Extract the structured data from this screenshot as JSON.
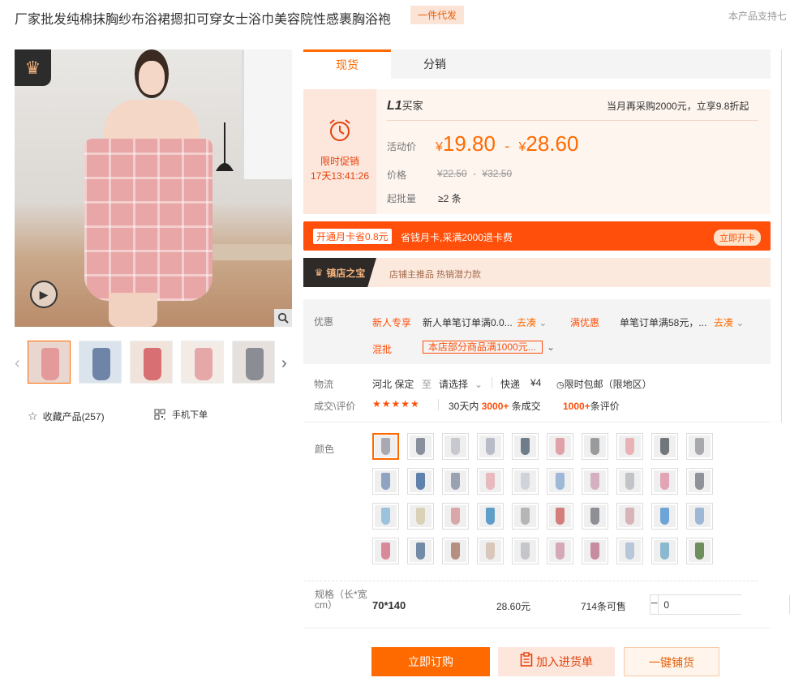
{
  "header": {
    "title": "厂家批发纯棉抹胸纱布浴裙摁扣可穿女士浴巾美容院性感裹胸浴袍",
    "dropship_tag": "一件代发",
    "support_text": "本产品支持七"
  },
  "gallery": {
    "zoom_icon": "magnifier-icon",
    "play_icon": "play-icon",
    "prev_icon": "chevron-left-icon",
    "next_icon": "chevron-right-icon",
    "thumb_count": 5,
    "favorite_label": "收藏产品(257)",
    "mobile_order_label": "手机下单"
  },
  "tabs": [
    {
      "label": "现货",
      "active": true
    },
    {
      "label": "分销",
      "active": false
    }
  ],
  "promo": {
    "badge_label": "限时促销",
    "countdown": "17天13:41:26",
    "level_code": "L1",
    "level_name": "买家",
    "level_hint": "当月再采购2000元，立享9.8折起",
    "activity_price_label": "活动价",
    "currency": "¥",
    "price_low": "19.80",
    "price_sep": "-",
    "price_high": "28.60",
    "orig_price_label": "价格",
    "orig_low": "22.50",
    "orig_high": "32.50",
    "moq_label": "起批量",
    "moq_value": "≥2 条"
  },
  "month_card": {
    "tag": "开通月卡省0.8元",
    "text": "省钱月卡,采满2000退卡费",
    "button": "立即开卡"
  },
  "treasure": {
    "title": "镇店之宝",
    "text": "店铺主推品  热销潜力款"
  },
  "offers": {
    "label": "优惠",
    "new_tag": "新人专享",
    "new_text": "新人单笔订单满0.0...",
    "go_label": "去凑",
    "full_tag": "满优惠",
    "full_text": "单笔订单满58元，...",
    "mix_tag": "混批",
    "mix_text": "本店部分商品满1000元..."
  },
  "logistics": {
    "label": "物流",
    "from": "河北 保定",
    "to_word": "至",
    "select_label": "请选择",
    "express": "快递",
    "fee": "¥4",
    "free_ship": "限时包邮（限地区）"
  },
  "deal": {
    "label": "成交\\评价",
    "stars": "★★★★★",
    "sold_prefix": "30天内",
    "sold_count": "3000+",
    "sold_unit": "条成交",
    "review_count": "1000+",
    "review_unit": "条评价"
  },
  "colors": {
    "label": "颜色",
    "swatches": [
      "#a9a9b3",
      "#8a8f9e",
      "#c7c9cf",
      "#b7bcc6",
      "#6f7c8a",
      "#e0a1a8",
      "#9a9b9d",
      "#e9b3b5",
      "#72777b",
      "#a7a9ad",
      "#8fa3c3",
      "#5f82ad",
      "#9aa2b1",
      "#e8b9bd",
      "#cfd4da",
      "#9fb8d8",
      "#d5b0c1",
      "#c2c4c8",
      "#e3a5b5",
      "#8e9399",
      "#9cc3dd",
      "#d9d2b8",
      "#d9a7aa",
      "#5e9ec8",
      "#b6b6b6",
      "#d47d7d",
      "#8d8f95",
      "#d8b3b8",
      "#6ea5d7",
      "#9db7d6",
      "#d88a9a",
      "#738aa7",
      "#b58f80",
      "#d9c7bb",
      "#c4c6cc",
      "#d4a9b5",
      "#c68ca0",
      "#b7c6d9",
      "#8ab9cf",
      "#6f8e5d"
    ]
  },
  "spec": {
    "label": "规格（长*宽cm）",
    "name": "70*140",
    "price": "28.60元",
    "stock": "714条可售",
    "minus": "−",
    "plus": "+",
    "quantity": "0"
  },
  "actions": {
    "order": "立即订购",
    "add_cart": "加入进货单",
    "distribute": "一键铺货"
  },
  "accent_color": "#ff6a00"
}
